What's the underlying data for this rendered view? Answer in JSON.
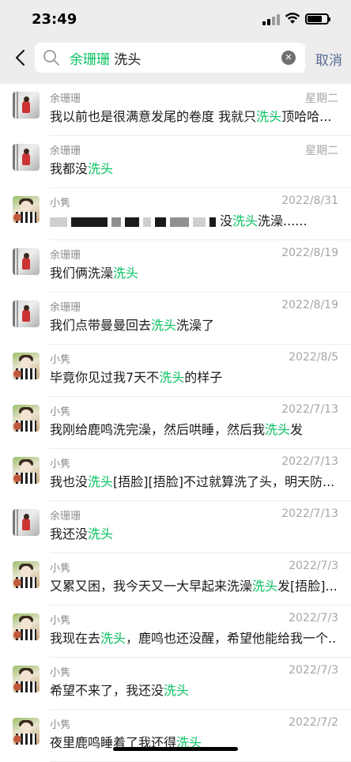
{
  "status": {
    "time": "23:49"
  },
  "search": {
    "contact": "余珊珊",
    "keyword": "洗头",
    "cancel_label": "取消"
  },
  "results": [
    {
      "name": "余珊珊",
      "date": "星期二",
      "avatar": "lady-icon",
      "parts": [
        "我以前也是很满意发尾的卷度 我就只",
        "洗头",
        "顶哈哈..."
      ]
    },
    {
      "name": "余珊珊",
      "date": "星期二",
      "avatar": "lady-icon",
      "parts": [
        "我都没",
        "洗头",
        ""
      ]
    },
    {
      "name": "小隽",
      "date": "2022/8/31",
      "avatar": "kid-icon",
      "blurred": true,
      "parts": [
        "没",
        "洗头",
        "洗澡......"
      ]
    },
    {
      "name": "余珊珊",
      "date": "2022/8/19",
      "avatar": "lady-icon",
      "parts": [
        "我们俩洗澡",
        "洗头",
        ""
      ]
    },
    {
      "name": "余珊珊",
      "date": "2022/8/19",
      "avatar": "lady-icon",
      "parts": [
        "我们点带曼曼回去",
        "洗头",
        "洗澡了"
      ]
    },
    {
      "name": "小隽",
      "date": "2022/8/5",
      "avatar": "kid-icon",
      "parts": [
        "毕竟你见过我7天不",
        "洗头",
        "的样子"
      ]
    },
    {
      "name": "小隽",
      "date": "2022/7/13",
      "avatar": "kid-icon",
      "parts": [
        "我刚给鹿鸣洗完澡，然后哄睡，然后我",
        "洗头",
        "发"
      ]
    },
    {
      "name": "小隽",
      "date": "2022/7/13",
      "avatar": "kid-icon",
      "parts": [
        "我也没",
        "洗头",
        "[捂脸][捂脸]不过就算洗了头，明天防..."
      ]
    },
    {
      "name": "余珊珊",
      "date": "2022/7/13",
      "avatar": "lady-icon",
      "parts": [
        "我还没",
        "洗头",
        ""
      ]
    },
    {
      "name": "小隽",
      "date": "2022/7/3",
      "avatar": "kid-icon",
      "parts": [
        "又累又困，我今天又一大早起来洗澡",
        "洗头",
        "发[捂脸]..."
      ]
    },
    {
      "name": "小隽",
      "date": "2022/7/3",
      "avatar": "kid-icon",
      "parts": [
        "我现在去",
        "洗头",
        "，鹿鸣也还没醒，希望他能给我一个..."
      ]
    },
    {
      "name": "小隽",
      "date": "2022/7/3",
      "avatar": "kid-icon",
      "parts": [
        "希望不来了，我还没",
        "洗头",
        ""
      ]
    },
    {
      "name": "小隽",
      "date": "2022/7/2",
      "avatar": "kid-icon",
      "parts": [
        "夜里鹿鸣睡着了我还得",
        "洗头",
        ""
      ]
    }
  ]
}
